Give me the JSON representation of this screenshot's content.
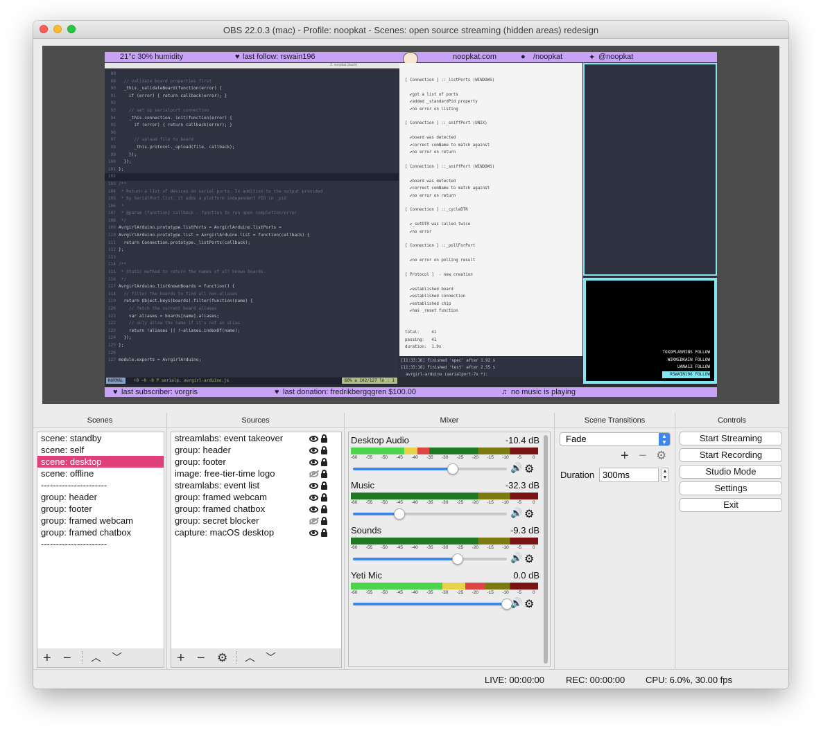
{
  "window": {
    "title": "OBS 22.0.3 (mac) - Profile: noopkat - Scenes: open source streaming (hidden areas) redesign"
  },
  "preview": {
    "top_bar": {
      "weather": "21°c 30% humidity",
      "last_follow": "last follow: rswain196",
      "site": "noopkat.com",
      "github": "/noopkat",
      "twitter": "@noopkat"
    },
    "bottom_bar": {
      "last_subscriber": "last subscriber: vorgris",
      "last_donation": "last donation: fredrikbergqgren $100.00",
      "music": "no music is playing"
    },
    "editor_tab": "2. noopkat (bash)",
    "code_lines": [
      {
        "n": "88",
        "t": ""
      },
      {
        "n": "89",
        "t": "  // validate board properties first"
      },
      {
        "n": "90",
        "t": "  _this._validateBoard(function(error) {"
      },
      {
        "n": "91",
        "t": "    if (error) { return callback(error); }"
      },
      {
        "n": "92",
        "t": ""
      },
      {
        "n": "93",
        "t": "    // set up serialport connection"
      },
      {
        "n": "94",
        "t": "    _this.connection._init(function(error) {"
      },
      {
        "n": "95",
        "t": "      if (error) { return callback(error); }"
      },
      {
        "n": "96",
        "t": ""
      },
      {
        "n": "97",
        "t": "      // upload file to board"
      },
      {
        "n": "98",
        "t": "      _this.protocol._upload(file, callback);"
      },
      {
        "n": "99",
        "t": "    });"
      },
      {
        "n": "100",
        "t": "  });"
      },
      {
        "n": "101",
        "t": "};"
      },
      {
        "n": "102",
        "t": ""
      },
      {
        "n": "103",
        "t": "/**"
      },
      {
        "n": "104",
        "t": " * Return a list of devices on serial ports. In addition to the output provided"
      },
      {
        "n": "105",
        "t": " * by SerialPort.list, it adds a platform independent PID in _pid"
      },
      {
        "n": "106",
        "t": " *"
      },
      {
        "n": "107",
        "t": " * @param {function} callback - function to run upon completion/error"
      },
      {
        "n": "108",
        "t": " */"
      },
      {
        "n": "109",
        "t": "AvrgirlArduino.prototype.listPorts = AvrgirlArduino.listPorts ="
      },
      {
        "n": "110",
        "t": "AvrgirlArduino.prototype.list = AvrgirlArduino.list = function(callback) {"
      },
      {
        "n": "111",
        "t": "  return Connection.prototype._listPorts(callback);"
      },
      {
        "n": "112",
        "t": "};"
      },
      {
        "n": "113",
        "t": ""
      },
      {
        "n": "114",
        "t": "/**"
      },
      {
        "n": "115",
        "t": " * Static method to return the names of all known boards."
      },
      {
        "n": "116",
        "t": " */"
      },
      {
        "n": "117",
        "t": "AvrgirlArduino.listKnownBoards = function() {"
      },
      {
        "n": "118",
        "t": "  // filter the boards to find all non-aliases"
      },
      {
        "n": "119",
        "t": "  return Object.keys(boards).filter(function(name) {"
      },
      {
        "n": "120",
        "t": "    // fetch the current board aliases"
      },
      {
        "n": "121",
        "t": "    var aliases = boards[name].aliases;"
      },
      {
        "n": "122",
        "t": "    // only allow the name if it's not an alias"
      },
      {
        "n": "123",
        "t": "    return !aliases || !~aliases.indexOf(name);"
      },
      {
        "n": "124",
        "t": "  });"
      },
      {
        "n": "125",
        "t": "};"
      },
      {
        "n": "126",
        "t": ""
      },
      {
        "n": "127",
        "t": "module.exports = AvrgirlArduino;"
      }
    ],
    "statusline": {
      "mode": "NORMAL",
      "info": "+0 ~0 -0 P serialp.   avrgirl-arduino.js",
      "position": "60% ≡ 102/127 ln : 1"
    },
    "terminal_text": "[ Connection ] ::_listPorts (WINDOWS)\n\n  ✔got a list of ports\n  ✔added _standardPid property\n  ✔no error on listing\n\n[ Connection ] ::_sniffPort (UNIX)\n\n  ✔board was detected\n  ✔correct comName to match against\n  ✔no error on return\n\n[ Connection ] ::_sniffPort (WINDOWS)\n\n  ✔board was detected\n  ✔correct comName to match against\n  ✔no error on return\n\n[ Connection ] ::_cycleDTR\n\n  ✔_setDTR was called twice\n  ✔no error\n\n[ Connection ] ::_pollForPort\n\n  ✔no error on polling result\n\n[ Protocol ]  - new creation\n\n  ✔established board\n  ✔established connection\n  ✔established chip\n  ✔has _reset function\n\n\ntotal:     41\npassing:   41\nduration:  1.9s",
    "terminal_bottom": "[11:33:16] Finished 'spec' after 1.92 s\n[11:33:16] Finished 'test' after 2.55 s\n  avrgirl-arduino (serialport-7x *): ",
    "followers": [
      "TOXOPLASMINS  FOLLOW",
      "WIKKEDKAIN  FOLLOW",
      "UANA13  FOLLOW",
      "RSWAIN196  FOLLOW"
    ]
  },
  "scenes": {
    "header": "Scenes",
    "items": [
      "scene: standby",
      "scene: self",
      "scene: desktop",
      "scene: offline",
      "----------------------",
      "group: header",
      "group: footer",
      "group: framed webcam",
      "group: framed chatbox",
      "----------------------"
    ],
    "selected_index": 2
  },
  "sources": {
    "header": "Sources",
    "items": [
      {
        "name": "streamlabs: event takeover",
        "visible": true
      },
      {
        "name": "group: header",
        "visible": true
      },
      {
        "name": "group: footer",
        "visible": true
      },
      {
        "name": "image: free-tier-time logo",
        "visible": false
      },
      {
        "name": "streamlabs: event list",
        "visible": true
      },
      {
        "name": "group: framed webcam",
        "visible": true
      },
      {
        "name": "group: framed chatbox",
        "visible": true
      },
      {
        "name": "group: secret blocker",
        "visible": false
      },
      {
        "name": "capture: macOS desktop",
        "visible": true
      }
    ]
  },
  "mixer": {
    "header": "Mixer",
    "tick_labels": [
      "-60",
      "-55",
      "-50",
      "-45",
      "-40",
      "-35",
      "-30",
      "-25",
      "-20",
      "-15",
      "-10",
      "-5",
      "0"
    ],
    "channels": [
      {
        "name": "Desktop Audio",
        "db": "-10.4 dB",
        "volume": 0.65,
        "level": 0.42
      },
      {
        "name": "Music",
        "db": "-32.3 dB",
        "volume": 0.3,
        "level": 0.0
      },
      {
        "name": "Sounds",
        "db": "-9.3 dB",
        "volume": 0.68,
        "level": 0.0
      },
      {
        "name": "Yeti Mic",
        "db": "0.0 dB",
        "volume": 1.0,
        "level": 0.72
      }
    ]
  },
  "transitions": {
    "header": "Scene Transitions",
    "selected": "Fade",
    "duration_label": "Duration",
    "duration_value": "300ms"
  },
  "controls": {
    "header": "Controls",
    "start_streaming": "Start Streaming",
    "start_recording": "Start Recording",
    "studio_mode": "Studio Mode",
    "settings": "Settings",
    "exit": "Exit"
  },
  "statusbar": {
    "live": "LIVE: 00:00:00",
    "rec": "REC: 00:00:00",
    "cpu": "CPU: 6.0%, 30.00 fps"
  },
  "colors": {
    "accent_bar": "#c7a2f5",
    "frame_cyan": "#81e7f0",
    "selected_scene": "#e0407a",
    "slider_blue": "#3d86ea"
  }
}
